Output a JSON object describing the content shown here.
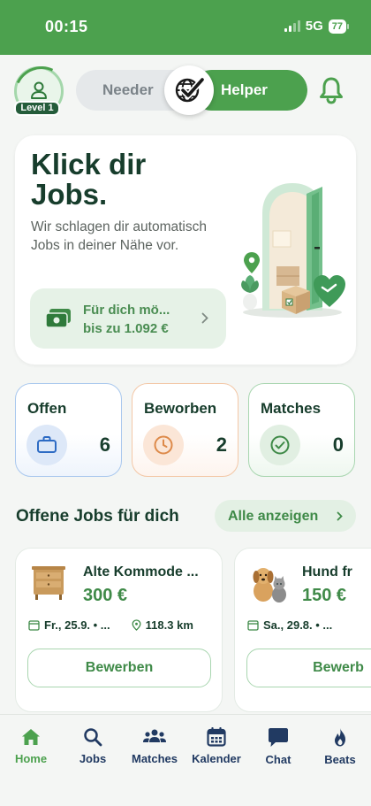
{
  "status_bar": {
    "time": "00:15",
    "network": "5G",
    "battery": "77"
  },
  "profile": {
    "level": "Level 1"
  },
  "role_toggle": {
    "left": "Needer",
    "right": "Helper",
    "active": "Helper"
  },
  "hero": {
    "title": "Klick dir Jobs.",
    "subtitle": "Wir schlagen dir automatisch Jobs in deiner Nähe vor.",
    "cta_line1": "Für dich mö...",
    "cta_line2": "bis zu 1.092 €"
  },
  "stats": [
    {
      "label": "Offen",
      "value": "6",
      "icon": "briefcase-icon"
    },
    {
      "label": "Beworben",
      "value": "2",
      "icon": "clock-icon"
    },
    {
      "label": "Matches",
      "value": "0",
      "icon": "check-circle-icon"
    }
  ],
  "jobs_section": {
    "title": "Offene Jobs für dich",
    "show_all": "Alle anzeigen"
  },
  "jobs": [
    {
      "title": "Alte Kommode ...",
      "price": "300 €",
      "date": "Fr., 25.9. • ...",
      "distance": "118.3 km",
      "apply": "Bewerben",
      "thumb": "dresser"
    },
    {
      "title": "Hund fr",
      "price": "150 €",
      "date": "Sa., 29.8. • ...",
      "distance": "",
      "apply": "Bewerb",
      "thumb": "dog-and-cat"
    }
  ],
  "tabbar": {
    "items": [
      {
        "label": "Home",
        "icon": "home-icon"
      },
      {
        "label": "Jobs",
        "icon": "search-icon"
      },
      {
        "label": "Matches",
        "icon": "people-icon"
      },
      {
        "label": "Kalender",
        "icon": "calendar-icon"
      },
      {
        "label": "Chat",
        "icon": "chat-icon"
      },
      {
        "label": "Beats",
        "icon": "flame-icon"
      }
    ],
    "active": "Home"
  },
  "colors": {
    "brand_green": "#4ca14e",
    "dark_text": "#173d2c",
    "nav_text": "#213a62"
  }
}
